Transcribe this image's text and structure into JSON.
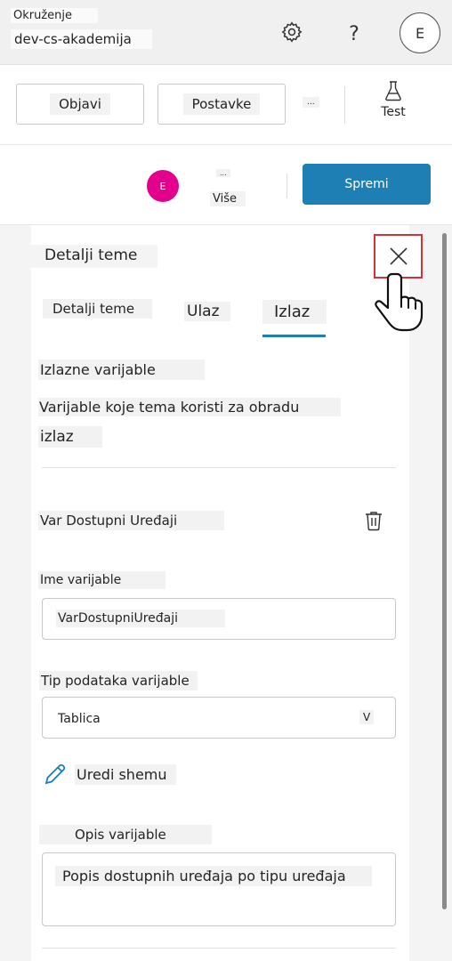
{
  "topbar": {
    "env_label": "Okruženje",
    "env_name": "dev-cs-akademija",
    "help_label": "?",
    "avatar_initial": "E"
  },
  "commandbar": {
    "publish_label": "Objavi",
    "settings_label": "Postavke",
    "more_dots": "...",
    "test_label": "Test"
  },
  "subbar": {
    "avatar_initial": "E",
    "avatar_color": "#e3008c",
    "more_dots": "...",
    "more_label": "Više",
    "save_label": "Spremi",
    "save_color": "#1d7fb3"
  },
  "panel": {
    "title": "Detalji teme",
    "tabs": [
      {
        "label": "Detalji teme"
      },
      {
        "label": "Ulaz"
      },
      {
        "label": "Izlaz",
        "selected": true
      }
    ],
    "section_title": "Izlazne varijable",
    "section_desc_line1": "Varijable koje tema koristi za obradu",
    "section_desc_line2": "izlaz",
    "variable": {
      "display_name": "Var Dostupni Uređaji",
      "name_label": "Ime varijable",
      "name_value": "VarDostupniUređaji",
      "type_label": "Tip podataka varijable",
      "type_value": "Tablica",
      "type_chevron": "V",
      "edit_schema_label": "Uredi shemu",
      "desc_label": "Opis varijable",
      "desc_value": "Popis dostupnih uređaja po tipu uređaja"
    }
  },
  "accent_color": "#d13438"
}
